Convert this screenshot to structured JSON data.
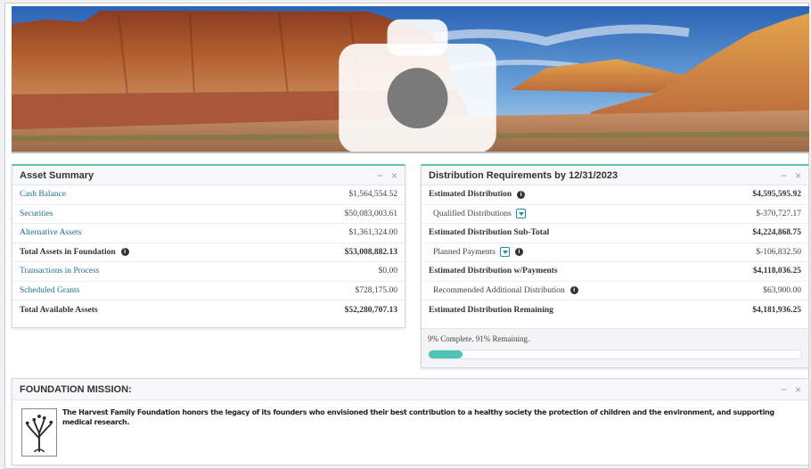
{
  "colors": {
    "accent": "#5cc6a6",
    "link": "#1f6f86",
    "progress": "#4fc3b6"
  },
  "banner": {
    "icon": "camera-icon"
  },
  "asset_summary": {
    "title": "Asset Summary",
    "rows": [
      {
        "label": "Cash Balance",
        "value": "$1,564,554.52"
      },
      {
        "label": "Securities",
        "value": "$50,083,003.61"
      },
      {
        "label": "Alternative Assets",
        "value": "$1,361,324.00"
      },
      {
        "label": "Total Assets in Foundation",
        "value": "$53,008,882.13"
      },
      {
        "label": "Transactions in Process",
        "value": "$0.00"
      },
      {
        "label": "Scheduled Grants",
        "value": "$728,175.00"
      },
      {
        "label": "Total Available Assets",
        "value": "$52,280,707.13"
      }
    ]
  },
  "distribution": {
    "title": "Distribution Requirements by 12/31/2023",
    "rows": [
      {
        "label": "Estimated Distribution",
        "value": "$4,595,595.92"
      },
      {
        "label": "Qualified Distributions",
        "value": "$-370,727.17"
      },
      {
        "label": "Estimated Distribution Sub-Total",
        "value": "$4,224,868.75"
      },
      {
        "label": "Planned Payments",
        "value": "$-106,832.50"
      },
      {
        "label": "Estimated Distribution w/Payments",
        "value": "$4,118,036.25"
      },
      {
        "label": "Recommended Additional Distribution",
        "value": "$63,900.00"
      },
      {
        "label": "Estimated Distribution Remaining",
        "value": "$4,181,936.25"
      }
    ],
    "progress_text": "9% Complete. 91% Remaining.",
    "progress_fraction": 0.09
  },
  "mission": {
    "title": "FOUNDATION MISSION:",
    "text": "The Harvest Family Foundation honors the legacy of its founders who envisioned their best contribution to a healthy society the protection of children and the environment, and supporting medical research."
  },
  "controls": {
    "minimize": "−",
    "close": "×"
  }
}
